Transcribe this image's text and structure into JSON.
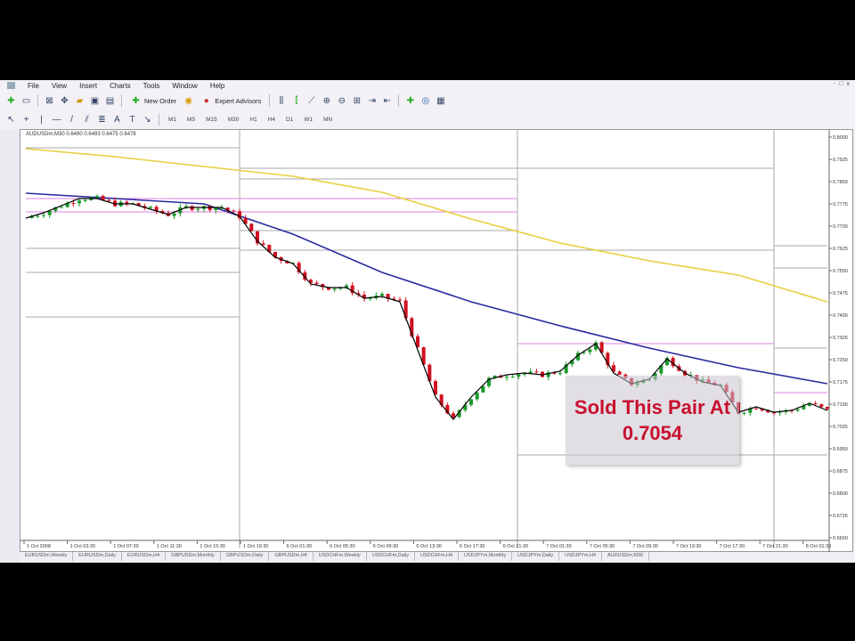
{
  "menu": [
    "File",
    "View",
    "Insert",
    "Charts",
    "Tools",
    "Window",
    "Help"
  ],
  "window_controls": [
    "-",
    "□",
    "x"
  ],
  "toolbar": {
    "new_order": "New Order",
    "expert_advisors": "Expert Advisors"
  },
  "timeframes": [
    "M1",
    "M5",
    "M15",
    "M30",
    "H1",
    "H4",
    "D1",
    "W1",
    "MN"
  ],
  "chart_header": "AUDUSDm,M30  0.6490 0.6493 0.6475 0.6478",
  "annotation": {
    "line1": "Sold This Pair At",
    "line2": "0.7054"
  },
  "bottom_tabs": [
    "EURUSDm,Weekly",
    "EURUSDm,Daily",
    "EURUSDm,H4",
    "GBPUSDm,Monthly",
    "GBPUSDm,Daily",
    "GBPUSDm,H4",
    "USDCHFm,Weekly",
    "USDCHFm,Daily",
    "USDCHFm,H4",
    "USDJPYm,Monthly",
    "USDJPYm,Daily",
    "USDJPYm,H4",
    "AUDUSDm,M30"
  ],
  "chart_data": {
    "type": "candlestick",
    "symbol": "AUDUSDm,M30",
    "ylim": [
      0.665,
      0.8
    ],
    "price_ticks": [
      "0.8000",
      "0.7925",
      "0.7850",
      "0.7775",
      "0.7700",
      "0.7625",
      "0.7550",
      "0.7475",
      "0.7400",
      "0.7325",
      "0.7250",
      "0.7175",
      "0.7100",
      "0.7025",
      "0.6950",
      "0.6875",
      "0.6800",
      "0.6725",
      "0.6650"
    ],
    "time_ticks": [
      "1 Oct 2008",
      "1 Oct 03:30",
      "1 Oct 07:30",
      "1 Oct 11:30",
      "1 Oct 15:30",
      "1 Oct 19:30",
      "6 Oct 01:30",
      "6 Oct 05:30",
      "6 Oct 09:30",
      "6 Oct 13:30",
      "6 Oct 17:30",
      "6 Oct 21:30",
      "7 Oct 01:30",
      "7 Oct 05:30",
      "7 Oct 09:30",
      "7 Oct 13:30",
      "7 Oct 17:30",
      "7 Oct 21:30",
      "8 Oct 01:30"
    ],
    "close": [
      0.7727,
      0.7745,
      0.7769,
      0.7793,
      0.7793,
      0.7775,
      0.7775,
      0.7757,
      0.7739,
      0.7763,
      0.7763,
      0.7763,
      0.7733,
      0.7649,
      0.7595,
      0.7574,
      0.7505,
      0.7493,
      0.7493,
      0.7457,
      0.7463,
      0.7445,
      0.7283,
      0.7124,
      0.7049,
      0.7124,
      0.7184,
      0.7199,
      0.7205,
      0.7199,
      0.7211,
      0.7265,
      0.7304,
      0.7205,
      0.7169,
      0.7184,
      0.7253,
      0.7205,
      0.7175,
      0.7163,
      0.7073,
      0.7091,
      0.7073,
      0.7079,
      0.7103,
      0.7079
    ],
    "ma_blue": [
      0.7811,
      0.7793,
      0.7775,
      0.7673,
      0.7544,
      0.7445,
      0.7364,
      0.7289,
      0.7223,
      0.7169
    ],
    "ma_yellow": [
      0.7961,
      0.7934,
      0.7901,
      0.7868,
      0.7814,
      0.7724,
      0.7643,
      0.7583,
      0.7535,
      0.7445
    ],
    "levels_gray": [
      [
        0,
        12,
        0.7964
      ],
      [
        0,
        12,
        0.7625
      ],
      [
        0,
        12,
        0.7544
      ],
      [
        0,
        12,
        0.7394
      ],
      [
        12,
        27.6,
        0.7895
      ],
      [
        12,
        27.6,
        0.7859
      ],
      [
        12,
        27.6,
        0.7685
      ],
      [
        12,
        27.6,
        0.7619
      ],
      [
        27.6,
        42,
        0.7895
      ],
      [
        27.6,
        42,
        0.7619
      ],
      [
        27.6,
        42,
        0.6929
      ],
      [
        42,
        45,
        0.7634
      ],
      [
        42,
        45,
        0.7559
      ],
      [
        42,
        45,
        0.7289
      ],
      [
        42,
        45,
        0.6929
      ]
    ],
    "levels_pink": [
      [
        0,
        27.6,
        0.7793
      ],
      [
        0,
        27.6,
        0.7748
      ],
      [
        27.6,
        42,
        0.7304
      ],
      [
        42,
        45,
        0.7139
      ]
    ],
    "colors": {
      "up": "#1a9a2a",
      "down": "#d01020",
      "close_line": "#000000",
      "ma_blue": "#2a2aa0",
      "ma_yellow": "#e8d040",
      "gray": "#aaaaaa",
      "pink": "#e080e0"
    }
  }
}
